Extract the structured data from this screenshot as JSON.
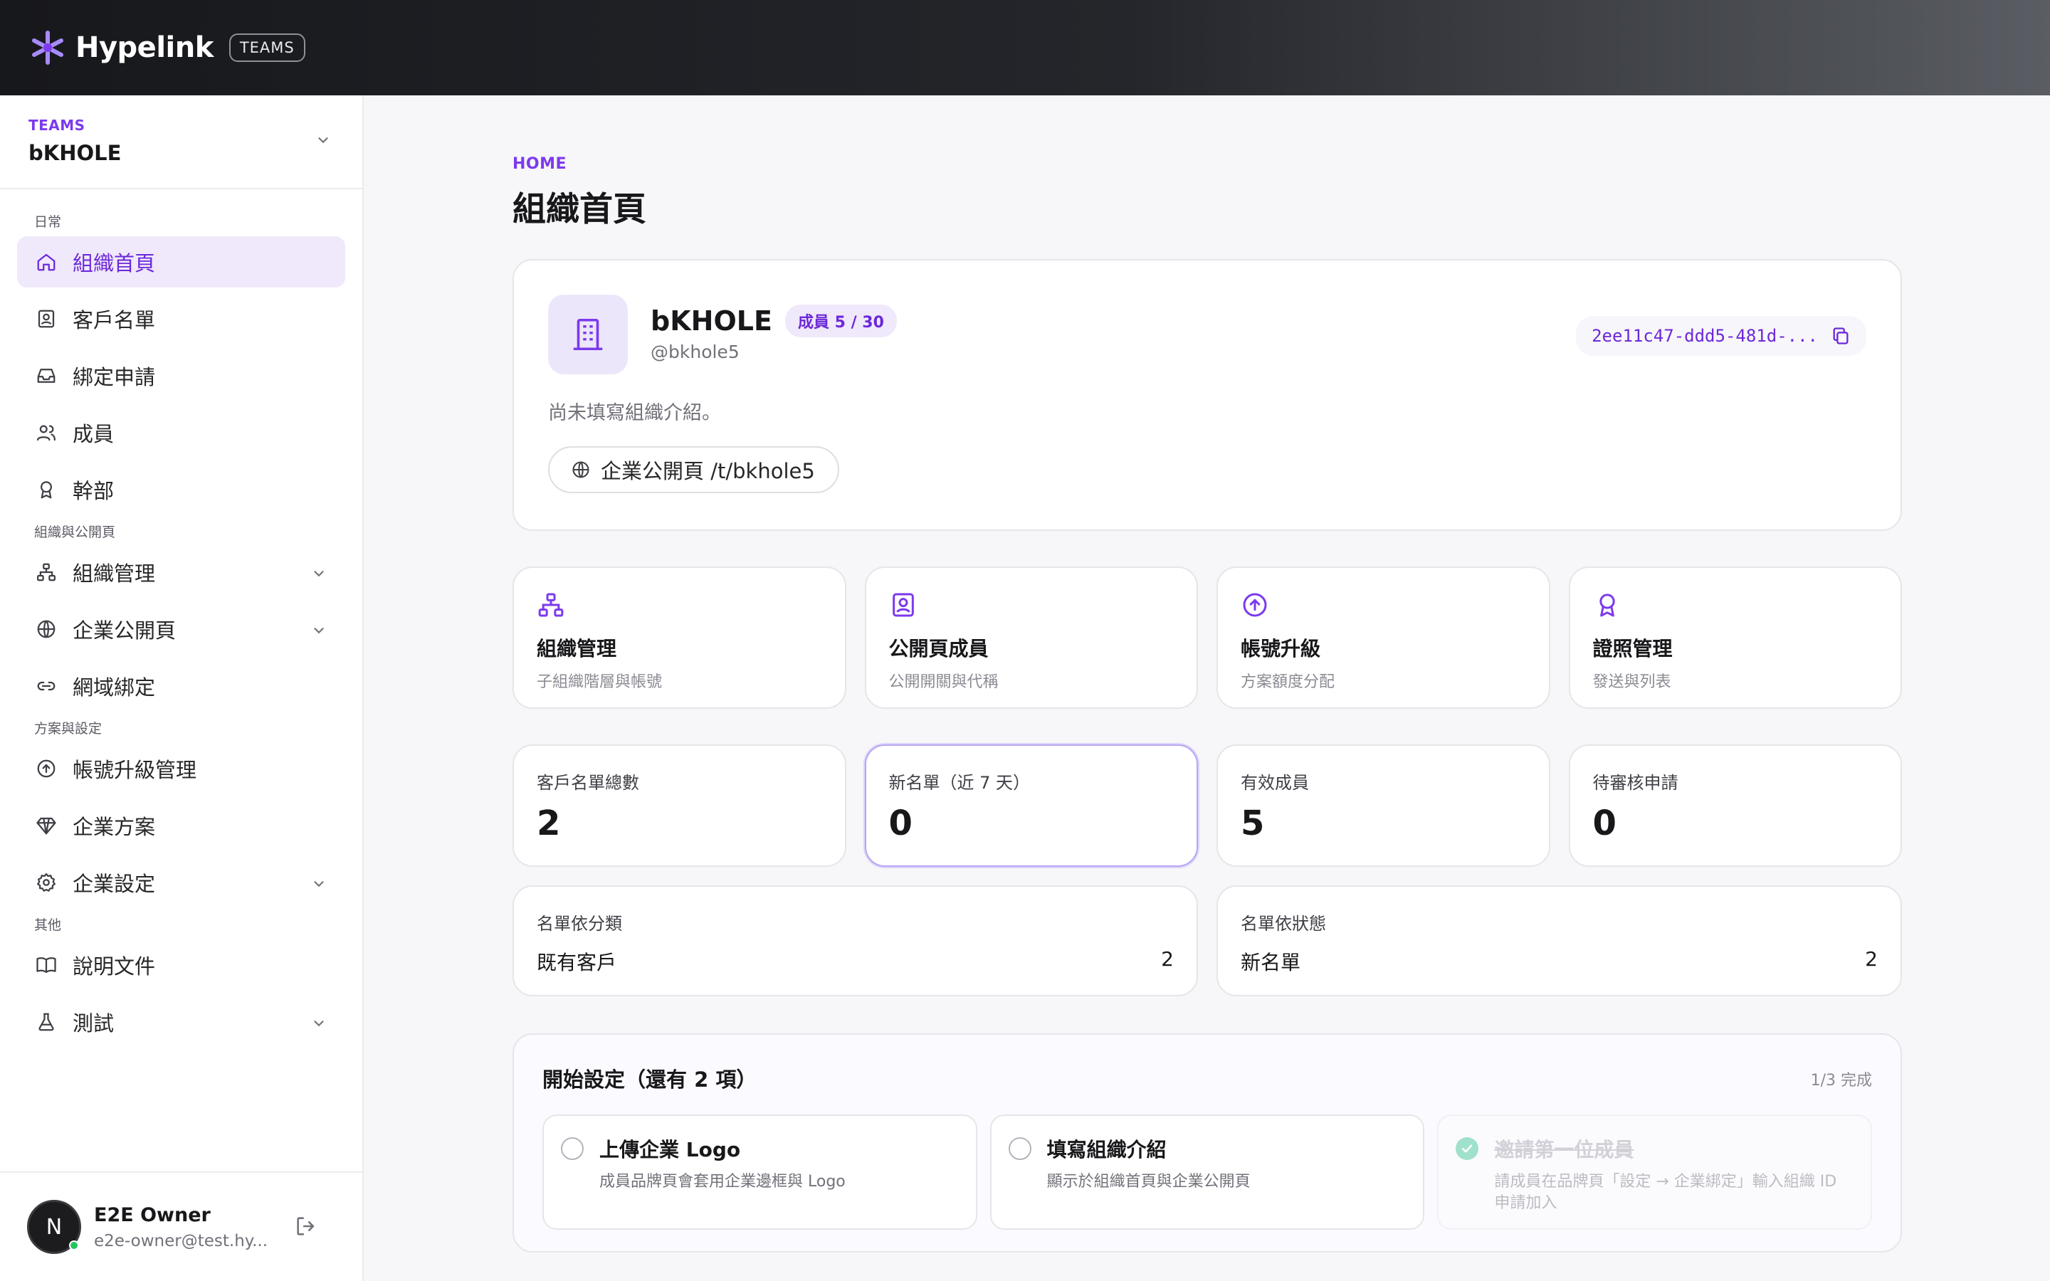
{
  "brand": {
    "name": "Hypelink",
    "badge": "TEAMS"
  },
  "team": {
    "label": "TEAMS",
    "name": "bKHOLE"
  },
  "sidebar": {
    "sections": [
      "日常",
      "組織與公開頁",
      "方案與設定",
      "其他"
    ],
    "items": [
      {
        "label": "組織首頁",
        "icon": "home-icon",
        "active": true
      },
      {
        "label": "客戶名單",
        "icon": "contact-card-icon"
      },
      {
        "label": "綁定申請",
        "icon": "inbox-icon"
      },
      {
        "label": "成員",
        "icon": "users-icon"
      },
      {
        "label": "幹部",
        "icon": "award-icon"
      },
      {
        "label": "組織管理",
        "icon": "org-chart-icon",
        "expandable": true
      },
      {
        "label": "企業公開頁",
        "icon": "globe-icon",
        "expandable": true
      },
      {
        "label": "網域綁定",
        "icon": "link-icon"
      },
      {
        "label": "帳號升級管理",
        "icon": "upgrade-circle-icon"
      },
      {
        "label": "企業方案",
        "icon": "diamond-icon"
      },
      {
        "label": "企業設定",
        "icon": "gear-icon",
        "expandable": true
      },
      {
        "label": "說明文件",
        "icon": "book-icon"
      },
      {
        "label": "測試",
        "icon": "flask-icon",
        "expandable": true
      }
    ]
  },
  "user": {
    "initial": "N",
    "name": "E2E Owner",
    "email": "e2e-owner@test.hy..."
  },
  "page": {
    "breadcrumb": "HOME",
    "title": "組織首頁"
  },
  "org": {
    "name": "bKHOLE",
    "members_badge": "成員 5 / 30",
    "handle": "@bkhole5",
    "id": "2ee11c47-ddd5-481d-...",
    "description": "尚未填寫組織介紹。",
    "public_page": "企業公開頁 /t/bkhole5"
  },
  "quick_links": [
    {
      "title": "組織管理",
      "subtitle": "子組織階層與帳號",
      "icon": "org-chart-icon"
    },
    {
      "title": "公開頁成員",
      "subtitle": "公開開關與代稱",
      "icon": "contact-card-icon"
    },
    {
      "title": "帳號升級",
      "subtitle": "方案額度分配",
      "icon": "upgrade-circle-icon"
    },
    {
      "title": "證照管理",
      "subtitle": "發送與列表",
      "icon": "award-icon"
    }
  ],
  "stats": [
    {
      "label": "客戶名單總數",
      "value": "2"
    },
    {
      "label": "新名單（近 7 天）",
      "value": "0"
    },
    {
      "label": "有效成員",
      "value": "5"
    },
    {
      "label": "待審核申請",
      "value": "0"
    }
  ],
  "breakdowns": [
    {
      "label": "名單依分類",
      "key": "既有客戶",
      "value": "2"
    },
    {
      "label": "名單依狀態",
      "key": "新名單",
      "value": "2"
    }
  ],
  "setup": {
    "title": "開始設定（還有 2 項）",
    "progress": "1/3 完成",
    "tasks": [
      {
        "title": "上傳企業 Logo",
        "desc": "成員品牌頁會套用企業邊框與 Logo",
        "done": false
      },
      {
        "title": "填寫組織介紹",
        "desc": "顯示於組織首頁與企業公開頁",
        "done": false
      },
      {
        "title": "邀請第一位成員",
        "desc": "請成員在品牌頁「設定 → 企業綁定」輸入組織 ID 申請加入",
        "done": true
      }
    ]
  },
  "colors": {
    "accent": "#7c3aed",
    "accent_bg": "#efe9fb",
    "success": "#34c38f"
  }
}
